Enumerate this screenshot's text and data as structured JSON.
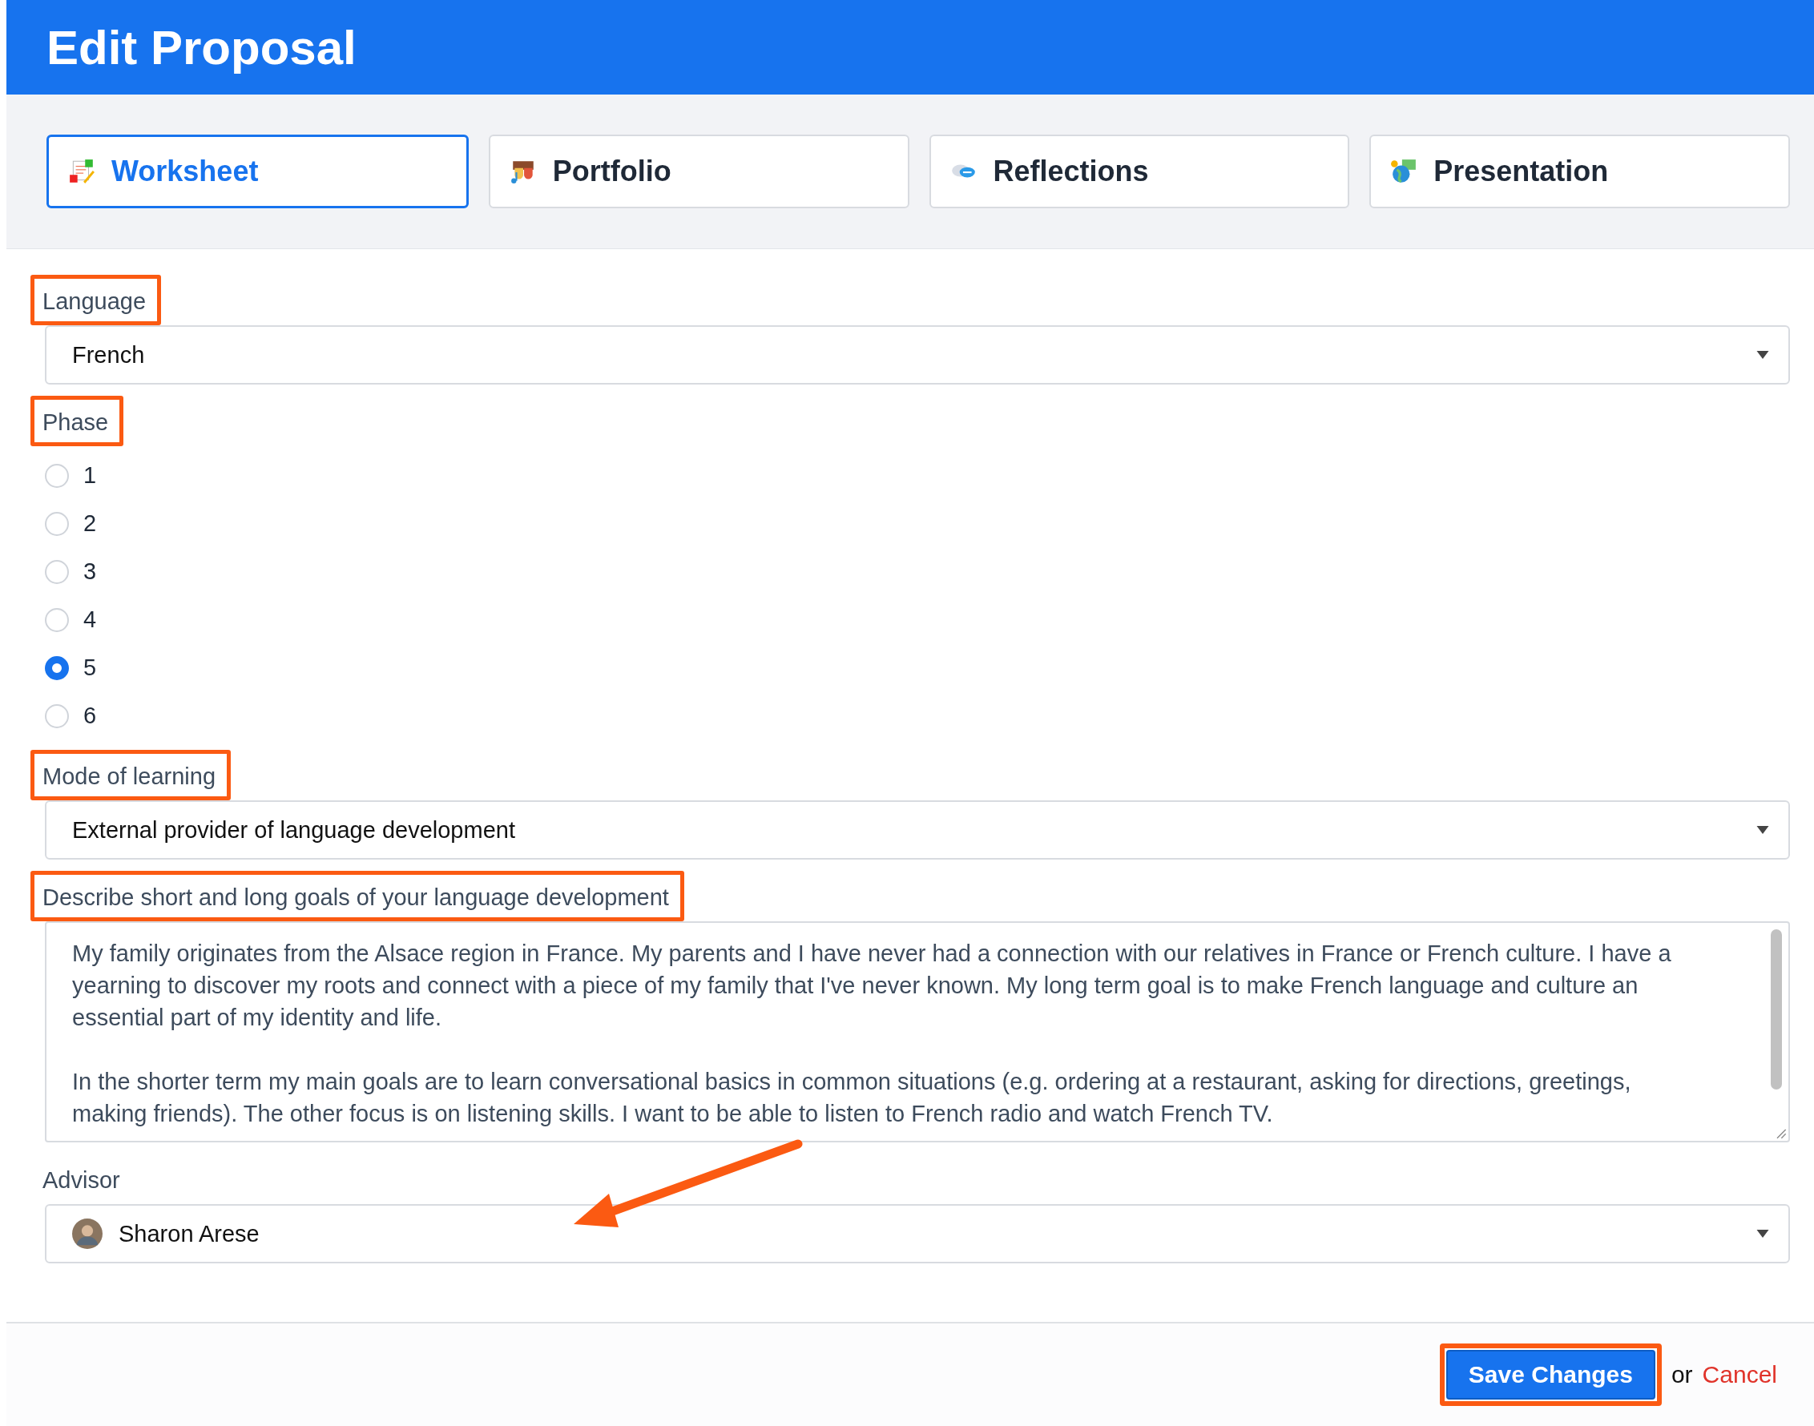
{
  "header": {
    "title": "Edit Proposal"
  },
  "tabs": [
    {
      "label": "Worksheet",
      "selected": true,
      "kind": "worksheet"
    },
    {
      "label": "Portfolio",
      "selected": false,
      "kind": "portfolio"
    },
    {
      "label": "Reflections",
      "selected": false,
      "kind": "reflections"
    },
    {
      "label": "Presentation",
      "selected": false,
      "kind": "presentation"
    }
  ],
  "fields": [
    {
      "kind": "select",
      "label": "Language",
      "highlighted": true,
      "value": "French"
    },
    {
      "kind": "radio",
      "label": "Phase",
      "highlighted": true,
      "options": [
        {
          "label": "1",
          "selected": false
        },
        {
          "label": "2",
          "selected": false
        },
        {
          "label": "3",
          "selected": false
        },
        {
          "label": "4",
          "selected": false
        },
        {
          "label": "5",
          "selected": true
        },
        {
          "label": "6",
          "selected": false
        }
      ]
    },
    {
      "kind": "select",
      "label": "Mode of learning",
      "highlighted": true,
      "value": "External provider of language development"
    },
    {
      "kind": "textarea",
      "label": "Describe short and long goals of your language development",
      "highlighted": true,
      "paragraphs": [
        "My family originates from the Alsace region in France. My parents and I have never had a connection with our relatives in France or French culture. I have a yearning to discover my roots and connect with a piece of my family that I've never known. My long term goal is to make French language and culture an essential part of my identity and life.",
        "In the shorter term my main goals are to learn conversational basics in common situations (e.g. ordering at a restaurant, asking for directions, greetings, making friends). The other focus is on listening skills. I want to be able to listen to French radio and watch French TV."
      ]
    },
    {
      "kind": "person",
      "label": "Advisor",
      "highlighted": false,
      "pointed": true,
      "value": "Sharon Arese"
    }
  ],
  "footer": {
    "save": {
      "label": "Save Changes",
      "highlighted": true
    },
    "or": "or",
    "cancel": "Cancel"
  }
}
